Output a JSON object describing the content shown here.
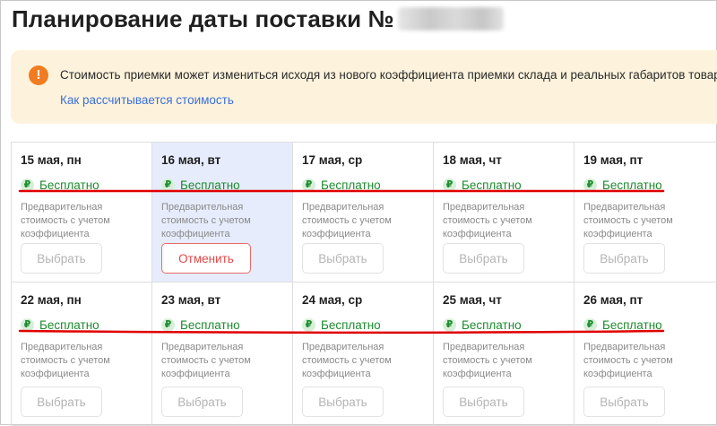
{
  "page": {
    "title": "Планирование даты поставки №"
  },
  "notice": {
    "icon": "exclamation-icon",
    "text": "Стоимость приемки может измениться исходя из нового коэффициента приемки склада и реальных габаритов товара.",
    "link": "Как рассчитывается стоимость"
  },
  "colors": {
    "accent_green": "#1d8b2e",
    "warning_orange": "#f07c22",
    "notice_bg": "#fdf3dc",
    "selected_bg": "#e6ecfb",
    "link_blue": "#3a6fd8",
    "cancel_red": "#e04848",
    "annotation_red": "#e00000"
  },
  "currency_symbol": "₽",
  "days": [
    {
      "date": "15 мая, пн",
      "price": "Бесплатно",
      "note": "Предварительная стоимость с учетом коэффициента",
      "button": "Выбрать",
      "selected": false
    },
    {
      "date": "16 мая, вт",
      "price": "Бесплатно",
      "note": "Предварительная стоимость с учетом коэффициента",
      "button": "Отменить",
      "selected": true
    },
    {
      "date": "17 мая, ср",
      "price": "Бесплатно",
      "note": "Предварительная стоимость с учетом коэффициента",
      "button": "Выбрать",
      "selected": false
    },
    {
      "date": "18 мая, чт",
      "price": "Бесплатно",
      "note": "Предварительная стоимость с учетом коэффициента",
      "button": "Выбрать",
      "selected": false
    },
    {
      "date": "19 мая, пт",
      "price": "Бесплатно",
      "note": "Предварительная стоимость с учетом коэффициента",
      "button": "Выбрать",
      "selected": false
    },
    {
      "date": "22 мая, пн",
      "price": "Бесплатно",
      "note": "Предварительная стоимость с учетом коэффициента",
      "button": "Выбрать",
      "selected": false
    },
    {
      "date": "23 мая, вт",
      "price": "Бесплатно",
      "note": "Предварительная стоимость с учетом коэффициента",
      "button": "Выбрать",
      "selected": false
    },
    {
      "date": "24 мая, ср",
      "price": "Бесплатно",
      "note": "Предварительная стоимость с учетом коэффициента",
      "button": "Выбрать",
      "selected": false
    },
    {
      "date": "25 мая, чт",
      "price": "Бесплатно",
      "note": "Предварительная стоимость с учетом коэффициента",
      "button": "Выбрать",
      "selected": false
    },
    {
      "date": "26 мая, пт",
      "price": "Бесплатно",
      "note": "Предварительная стоимость с учетом коэффициента",
      "button": "Выбрать",
      "selected": false
    }
  ]
}
